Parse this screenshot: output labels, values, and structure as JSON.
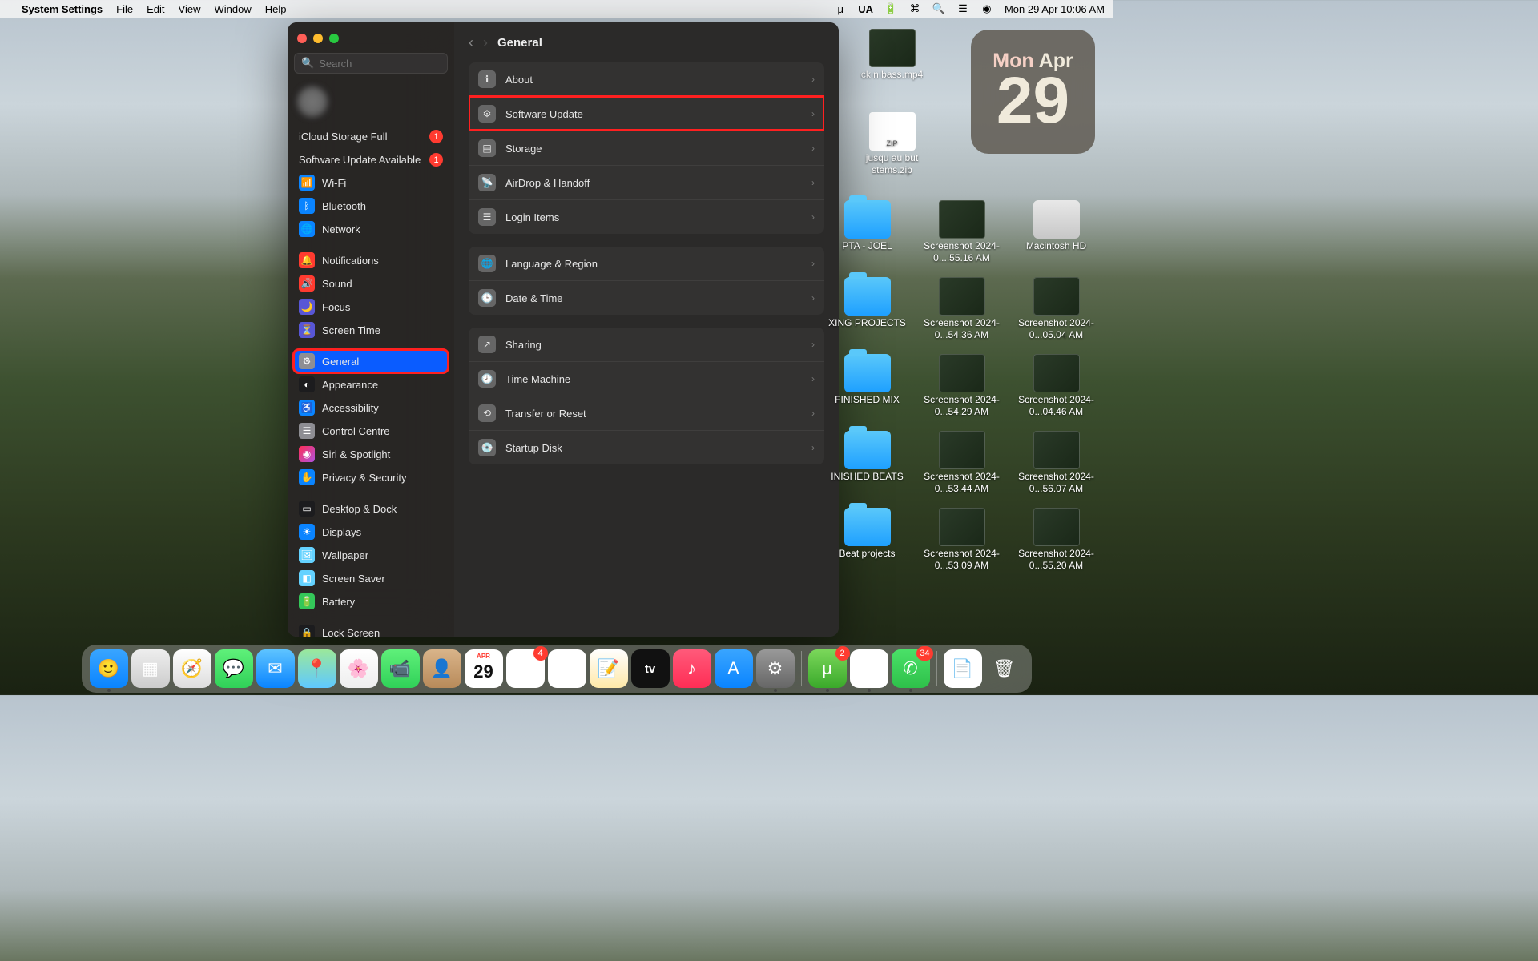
{
  "menubar": {
    "app": "System Settings",
    "items": [
      "File",
      "Edit",
      "View",
      "Window",
      "Help"
    ],
    "input": "UA",
    "datetime": "Mon 29 Apr  10:06 AM"
  },
  "date_widget": {
    "weekday": "Mon",
    "month": "Apr",
    "day": "29"
  },
  "desktop": [
    {
      "name": "ck n bass.mp4",
      "type": "screenshot"
    },
    {
      "name": "jusqu au but stems.zip",
      "type": "zip"
    },
    {
      "name": "PTA - JOEL",
      "type": "folder"
    },
    {
      "name": "Screenshot 2024-0....55.16 AM",
      "type": "screenshot"
    },
    {
      "name": "Macintosh HD",
      "type": "hd"
    },
    {
      "name": "XING PROJECTS",
      "type": "folder"
    },
    {
      "name": "Screenshot 2024-0...54.36 AM",
      "type": "screenshot"
    },
    {
      "name": "Screenshot 2024-0...05.04 AM",
      "type": "screenshot"
    },
    {
      "name": "FINISHED MIX",
      "type": "folder"
    },
    {
      "name": "Screenshot 2024-0...54.29 AM",
      "type": "screenshot"
    },
    {
      "name": "Screenshot 2024-0...04.46 AM",
      "type": "screenshot"
    },
    {
      "name": "INISHED BEATS",
      "type": "folder"
    },
    {
      "name": "Screenshot 2024-0...53.44 AM",
      "type": "screenshot"
    },
    {
      "name": "Screenshot 2024-0...56.07 AM",
      "type": "screenshot"
    },
    {
      "name": "Beat projects",
      "type": "folder"
    },
    {
      "name": "Screenshot 2024-0...53.09 AM",
      "type": "screenshot"
    },
    {
      "name": "Screenshot 2024-0...55.20 AM",
      "type": "screenshot"
    }
  ],
  "window": {
    "search_placeholder": "Search",
    "account": {
      "name": "",
      "sub": ""
    },
    "alerts": [
      {
        "label": "iCloud Storage Full",
        "badge": "1"
      },
      {
        "label": "Software Update Available",
        "badge": "1"
      }
    ],
    "nav": [
      [
        {
          "label": "Wi-Fi",
          "icon": "ic-blue",
          "glyph": "📶"
        },
        {
          "label": "Bluetooth",
          "icon": "ic-blue",
          "glyph": "ᛒ"
        },
        {
          "label": "Network",
          "icon": "ic-blue",
          "glyph": "🌐"
        }
      ],
      [
        {
          "label": "Notifications",
          "icon": "ic-red",
          "glyph": "🔔"
        },
        {
          "label": "Sound",
          "icon": "ic-red",
          "glyph": "🔊"
        },
        {
          "label": "Focus",
          "icon": "ic-purple",
          "glyph": "🌙"
        },
        {
          "label": "Screen Time",
          "icon": "ic-purple",
          "glyph": "⏳"
        }
      ],
      [
        {
          "label": "General",
          "icon": "ic-gray",
          "glyph": "⚙",
          "selected": true,
          "highlight": true
        },
        {
          "label": "Appearance",
          "icon": "ic-black",
          "glyph": "◐"
        },
        {
          "label": "Accessibility",
          "icon": "ic-blue",
          "glyph": "♿"
        },
        {
          "label": "Control Centre",
          "icon": "ic-gray",
          "glyph": "☰"
        },
        {
          "label": "Siri & Spotlight",
          "icon": "ic-pink",
          "glyph": "◉"
        },
        {
          "label": "Privacy & Security",
          "icon": "ic-blue",
          "glyph": "✋"
        }
      ],
      [
        {
          "label": "Desktop & Dock",
          "icon": "ic-black",
          "glyph": "▭"
        },
        {
          "label": "Displays",
          "icon": "ic-blue",
          "glyph": "☀"
        },
        {
          "label": "Wallpaper",
          "icon": "ic-cyan",
          "glyph": "🖼"
        },
        {
          "label": "Screen Saver",
          "icon": "ic-cyan",
          "glyph": "◧"
        },
        {
          "label": "Battery",
          "icon": "ic-green",
          "glyph": "🔋"
        }
      ],
      [
        {
          "label": "Lock Screen",
          "icon": "ic-black",
          "glyph": "🔒"
        }
      ]
    ],
    "content": {
      "title": "General",
      "groups": [
        [
          {
            "label": "About",
            "glyph": "ℹ"
          },
          {
            "label": "Software Update",
            "glyph": "⚙",
            "highlight": true
          },
          {
            "label": "Storage",
            "glyph": "▤"
          },
          {
            "label": "AirDrop & Handoff",
            "glyph": "📡"
          },
          {
            "label": "Login Items",
            "glyph": "☰"
          }
        ],
        [
          {
            "label": "Language & Region",
            "glyph": "🌐"
          },
          {
            "label": "Date & Time",
            "glyph": "🕒"
          }
        ],
        [
          {
            "label": "Sharing",
            "glyph": "↗"
          },
          {
            "label": "Time Machine",
            "glyph": "🕗"
          },
          {
            "label": "Transfer or Reset",
            "glyph": "⟲"
          },
          {
            "label": "Startup Disk",
            "glyph": "💽"
          }
        ]
      ]
    }
  },
  "dock": {
    "apps": [
      {
        "name": "finder",
        "bg": "linear-gradient(#39a5ff,#0a84ff)",
        "glyph": "🙂",
        "dot": true
      },
      {
        "name": "launchpad",
        "bg": "linear-gradient(#eee,#ccc)",
        "glyph": "▦"
      },
      {
        "name": "safari",
        "bg": "linear-gradient(#fff,#ddd)",
        "glyph": "🧭"
      },
      {
        "name": "messages",
        "bg": "linear-gradient(#5ff07a,#30d158)",
        "glyph": "💬"
      },
      {
        "name": "mail",
        "bg": "linear-gradient(#5ec4ff,#0a84ff)",
        "glyph": "✉"
      },
      {
        "name": "maps",
        "bg": "linear-gradient(#9be89b,#5fc8ff)",
        "glyph": "📍"
      },
      {
        "name": "photos",
        "bg": "linear-gradient(#fff,#eee)",
        "glyph": "🌸"
      },
      {
        "name": "facetime",
        "bg": "linear-gradient(#5ff07a,#30d158)",
        "glyph": "📹"
      },
      {
        "name": "contacts",
        "bg": "linear-gradient(#d9b48a,#b88a5a)",
        "glyph": "👤"
      },
      {
        "name": "calendar",
        "bg": "#fff",
        "glyph": "29"
      },
      {
        "name": "reminders",
        "bg": "#fff",
        "glyph": "☰",
        "badge": "4"
      },
      {
        "name": "freeform",
        "bg": "#fff",
        "glyph": "〰"
      },
      {
        "name": "notes",
        "bg": "linear-gradient(#fff,#ffe9a8)",
        "glyph": "📝"
      },
      {
        "name": "tv",
        "bg": "#111",
        "glyph": "tv"
      },
      {
        "name": "music",
        "bg": "linear-gradient(#ff5a7a,#ff2d55)",
        "glyph": "♪"
      },
      {
        "name": "appstore",
        "bg": "linear-gradient(#39a5ff,#0a84ff)",
        "glyph": "A"
      },
      {
        "name": "settings",
        "bg": "linear-gradient(#999,#666)",
        "glyph": "⚙",
        "dot": true
      }
    ],
    "right": [
      {
        "name": "utorrent",
        "bg": "linear-gradient(#7bd75b,#3aa92a)",
        "glyph": "μ",
        "badge": "2",
        "dot": true
      },
      {
        "name": "chrome",
        "bg": "#fff",
        "glyph": "◉",
        "dot": true
      },
      {
        "name": "whatsapp",
        "bg": "linear-gradient(#4ae168,#2ec04a)",
        "glyph": "✆",
        "badge": "34",
        "dot": true
      }
    ],
    "tray": [
      {
        "name": "document",
        "bg": "#fff",
        "glyph": "📄"
      },
      {
        "name": "trash",
        "bg": "transparent",
        "glyph": "🗑"
      }
    ]
  }
}
